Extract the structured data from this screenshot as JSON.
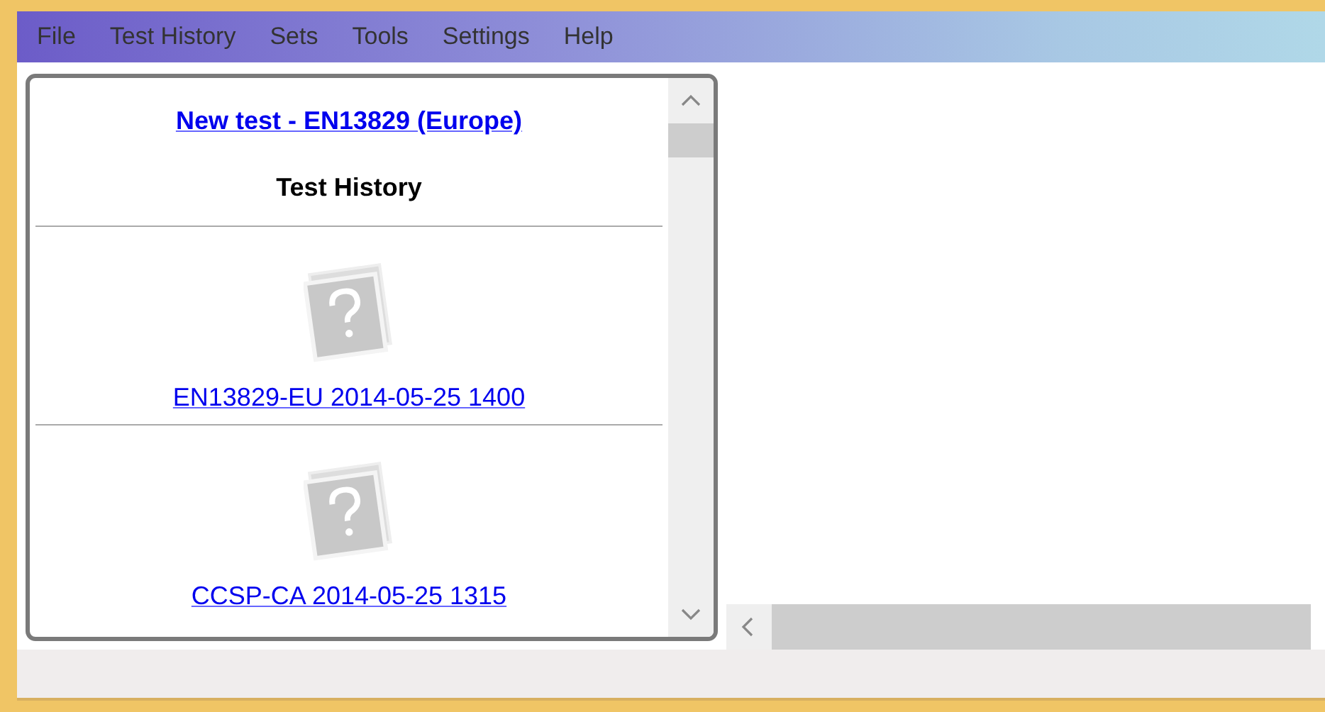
{
  "menu": [
    {
      "label": "File"
    },
    {
      "label": "Test History"
    },
    {
      "label": "Sets"
    },
    {
      "label": "Tools"
    },
    {
      "label": "Settings"
    },
    {
      "label": "Help"
    }
  ],
  "panel": {
    "new_test_link": "New test - EN13829 (Europe)",
    "heading": "Test History",
    "entries": [
      {
        "label": "EN13829-EU 2014-05-25 1400"
      },
      {
        "label": "CCSP-CA 2014-05-25 1315"
      }
    ]
  }
}
